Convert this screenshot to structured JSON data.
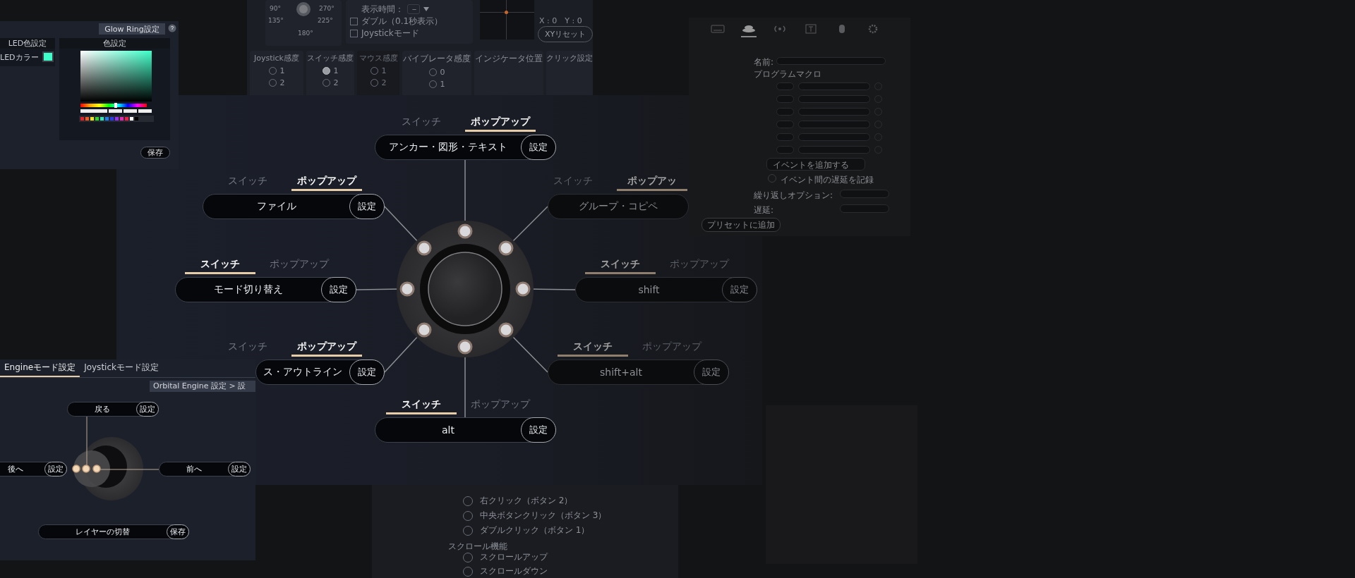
{
  "settings_panel": {
    "angle_labels": [
      "90°",
      "270°",
      "135°",
      "225°",
      "180°"
    ],
    "options": [
      {
        "kind": "select",
        "label": "表示時間：",
        "placeholder": "－"
      },
      {
        "kind": "checkbox",
        "label": "ダブル（0.1秒表示）",
        "checked": false
      },
      {
        "kind": "checkbox",
        "label": "Joystickモード",
        "checked": false
      }
    ],
    "xy_readout": "X : 0　Y : 0",
    "reset_button": "XYリセット",
    "sensitivity_panels": [
      {
        "title": "Joystick感度",
        "disabled": false,
        "options": [
          {
            "label": "1",
            "selected": false
          },
          {
            "label": "2",
            "selected": false
          }
        ]
      },
      {
        "title": "スイッチ感度",
        "disabled": false,
        "options": [
          {
            "label": "1",
            "selected": true
          },
          {
            "label": "2",
            "selected": false
          }
        ]
      },
      {
        "title": "マウス感度",
        "disabled": true,
        "options": [
          {
            "label": "1",
            "selected": false
          },
          {
            "label": "2",
            "selected": false
          }
        ]
      },
      {
        "title": "バイブレータ感度",
        "disabled": false,
        "options": [
          {
            "label": "0",
            "selected": false
          },
          {
            "label": "1",
            "selected": false
          }
        ]
      }
    ],
    "indicator_title": "インジケータ位置",
    "click_title": "クリック設定"
  },
  "mouse_window": {
    "options": [
      {
        "label": "右クリック（ボタン 2）",
        "selected": false
      },
      {
        "label": "中央ボタンクリック（ボタン 3）",
        "selected": false
      },
      {
        "label": "ダブルクリック（ボタン 1）",
        "selected": false
      }
    ],
    "section_title": "スクロール機能",
    "scroll_options": [
      {
        "label": "スクロールアップ",
        "selected": false
      },
      {
        "label": "スクロールダウン",
        "selected": false
      }
    ]
  },
  "orbital_panel": {
    "nodes": [
      {
        "mode_tabs": [
          {
            "label": "スイッチ",
            "selected": false
          },
          {
            "label": "ポップアップ",
            "selected": true
          }
        ],
        "label": "アンカー・図形・テキスト",
        "button": "設定",
        "dimmed": false
      },
      {
        "mode_tabs": [
          {
            "label": "スイッチ",
            "selected": false
          },
          {
            "label": "ポップアップ",
            "selected": true
          }
        ],
        "label": "ファイル",
        "button": "設定",
        "dimmed": false
      },
      {
        "mode_tabs": [
          {
            "label": "スイッチ",
            "selected": false
          },
          {
            "label": "ポップアッ",
            "selected": true
          }
        ],
        "label": "グループ・コピペ",
        "dimmed": true
      },
      {
        "mode_tabs": [
          {
            "label": "スイッチ",
            "selected": true
          },
          {
            "label": "ポップアップ",
            "selected": false
          }
        ],
        "label": "モード切り替え",
        "button": "設定",
        "dimmed": false
      },
      {
        "mode_tabs": [
          {
            "label": "スイッチ",
            "selected": true
          },
          {
            "label": "ポップアップ",
            "selected": false
          }
        ],
        "label": "shift",
        "button": "設定",
        "dimmed": true
      },
      {
        "mode_tabs": [
          {
            "label": "スイッチ",
            "selected": false
          },
          {
            "label": "ポップアップ",
            "selected": true
          }
        ],
        "label": "ス・アウトライン",
        "button": "設定",
        "dimmed": false
      },
      {
        "mode_tabs": [
          {
            "label": "スイッチ",
            "selected": true
          },
          {
            "label": "ポップアップ",
            "selected": false
          }
        ],
        "label": "shift+alt",
        "button": "設定",
        "dimmed": true
      },
      {
        "mode_tabs": [
          {
            "label": "スイッチ",
            "selected": true
          },
          {
            "label": "ポップアップ",
            "selected": false
          }
        ],
        "label": "alt",
        "button": "設定",
        "dimmed": false
      }
    ]
  },
  "glow_window": {
    "header_button": "Glow Ring設定",
    "led_panel": {
      "title": "LED色設定",
      "row_label": "LEDカラー"
    },
    "color_panel": {
      "title": "色設定",
      "hue_slider": {
        "level": 0.53
      },
      "palette": [
        {
          "color": "#e8202a"
        },
        {
          "color": "#f05a1e"
        },
        {
          "color": "#f2e21e"
        },
        {
          "color": "#2ed42a"
        },
        {
          "color": "#2ee8b8"
        },
        {
          "color": "#1e7ef0"
        },
        {
          "color": "#2a3cf0"
        },
        {
          "color": "#9a2ef0"
        },
        {
          "color": "#e82ab4"
        },
        {
          "color": "#f01e46"
        },
        {
          "color": "#ffffff"
        },
        {
          "color": "#000000"
        }
      ]
    },
    "save_button": "保存"
  },
  "macro_window": {
    "tabs": [
      {
        "kind": "keyboard",
        "selected": false
      },
      {
        "kind": "stack",
        "selected": true
      },
      {
        "kind": "wave",
        "selected": false
      },
      {
        "kind": "text",
        "selected": false
      },
      {
        "kind": "mouse",
        "selected": false
      },
      {
        "kind": "gear",
        "selected": false
      }
    ],
    "name_label": "名前:",
    "macro_label": "プログラムマクロ",
    "add_event": "イベントを追加する",
    "record_delay": {
      "label": "イベント間の遅延を記録",
      "checked": false
    },
    "repeat_label": "繰り返しオプション:",
    "delay_label": "遅延:",
    "preset_button": "プリセットに追加"
  },
  "engine_window": {
    "tabs": [
      {
        "label": "Engineモード設定",
        "selected": true
      },
      {
        "label": "Joystickモード設定",
        "selected": false
      }
    ],
    "breadcrumb": "Orbital Engine 設定 > 設",
    "nodes": [
      {
        "label": "戻る",
        "button": "設定"
      },
      {
        "label": "後へ",
        "button": "設定"
      },
      {
        "label": "前へ",
        "button": "設定"
      },
      {
        "label": "レイヤーの切替",
        "button": "保存"
      }
    ]
  }
}
